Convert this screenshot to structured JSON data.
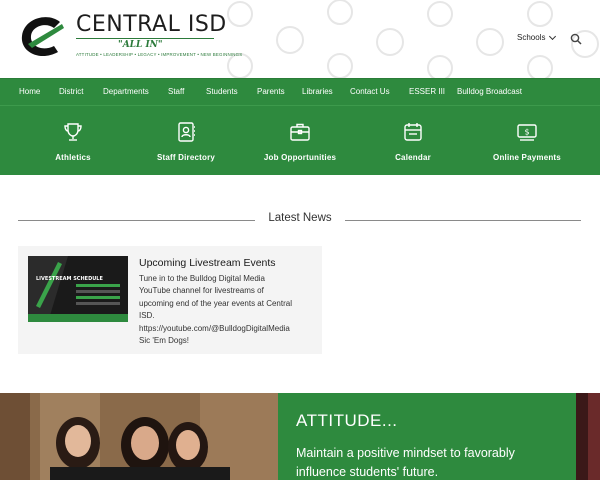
{
  "header": {
    "brand_name": "CENTRAL ISD",
    "slogan": "\"ALL IN\"",
    "values": "ATTITUDE • LEADERSHIP • LEGACY • IMPROVEMENT • NEW BEGINNINGS",
    "schools_label": "Schools",
    "logo_icon": "c-logo-icon",
    "search_icon": "search-icon"
  },
  "nav": {
    "items": [
      "Home",
      "District",
      "Departments",
      "Staff",
      "Students",
      "Parents",
      "Libraries",
      "Contact Us",
      "ESSER III",
      "Bulldog Broadcast"
    ]
  },
  "quick_links": [
    {
      "label": "Athletics",
      "icon": "trophy-icon"
    },
    {
      "label": "Staff Directory",
      "icon": "contact-book-icon"
    },
    {
      "label": "Job Opportunities",
      "icon": "briefcase-icon"
    },
    {
      "label": "Calendar",
      "icon": "calendar-icon"
    },
    {
      "label": "Online Payments",
      "icon": "payment-icon"
    }
  ],
  "news": {
    "heading": "Latest News",
    "card": {
      "title": "Upcoming Livestream Events",
      "body_lines": [
        "Tune in to the Bulldog Digital Media",
        "YouTube channel for livestreams of",
        "upcoming end of the year events at Central",
        "ISD.",
        "https://youtube.com/@BulldogDigitalMedia",
        "Sic 'Em Dogs!"
      ],
      "thumb_text": "LIVESTREAM SCHEDULE"
    }
  },
  "feature": {
    "heading": "ATTITUDE...",
    "text": "Maintain a positive mindset to favorably influence students' future."
  },
  "colors": {
    "green": "#2e8a3e",
    "dark_text": "#1d1d1d"
  }
}
